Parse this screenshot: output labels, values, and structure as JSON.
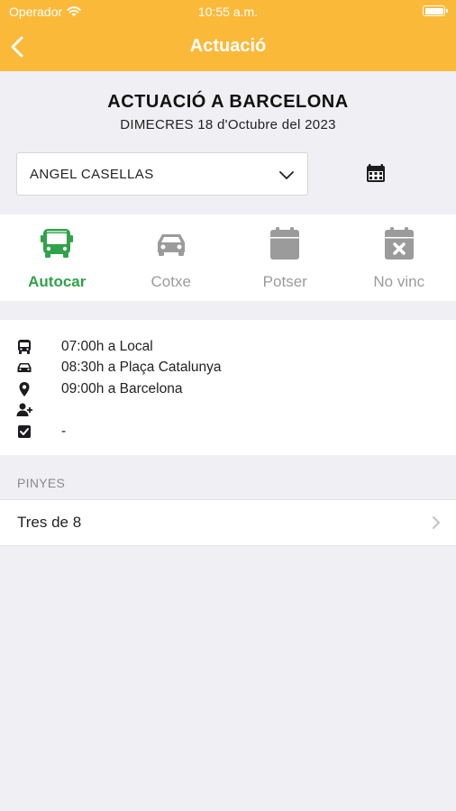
{
  "status_bar": {
    "carrier": "Operador",
    "time": "10:55 a.m."
  },
  "navbar": {
    "title": "Actuació"
  },
  "event": {
    "title": "ACTUACIÓ A BARCELONA",
    "date": "DIMECRES 18 d'Octubre del 2023"
  },
  "member_select": {
    "value": "ANGEL CASELLAS"
  },
  "transport_options": [
    {
      "label": "Autocar",
      "icon": "bus-icon",
      "active": true
    },
    {
      "label": "Cotxe",
      "icon": "car-icon",
      "active": false
    },
    {
      "label": "Potser",
      "icon": "calendar-icon",
      "active": false
    },
    {
      "label": "No vinc",
      "icon": "calendar-x-icon",
      "active": false
    }
  ],
  "details": [
    {
      "icon": "bus-icon",
      "text": "07:00h a Local"
    },
    {
      "icon": "car-icon",
      "text": "08:30h a Plaça Catalunya"
    },
    {
      "icon": "location-pin-icon",
      "text": "09:00h a Barcelona"
    },
    {
      "icon": "user-plus-icon",
      "text": ""
    },
    {
      "icon": "checkbox-icon",
      "text": "-"
    }
  ],
  "pinyes": {
    "section_title": "PINYES",
    "items": [
      {
        "label": "Tres de 8"
      }
    ]
  },
  "colors": {
    "accent": "#fbb93a",
    "active": "#2fa24a",
    "inactive": "#9b9b9b",
    "background": "#efeff4"
  }
}
